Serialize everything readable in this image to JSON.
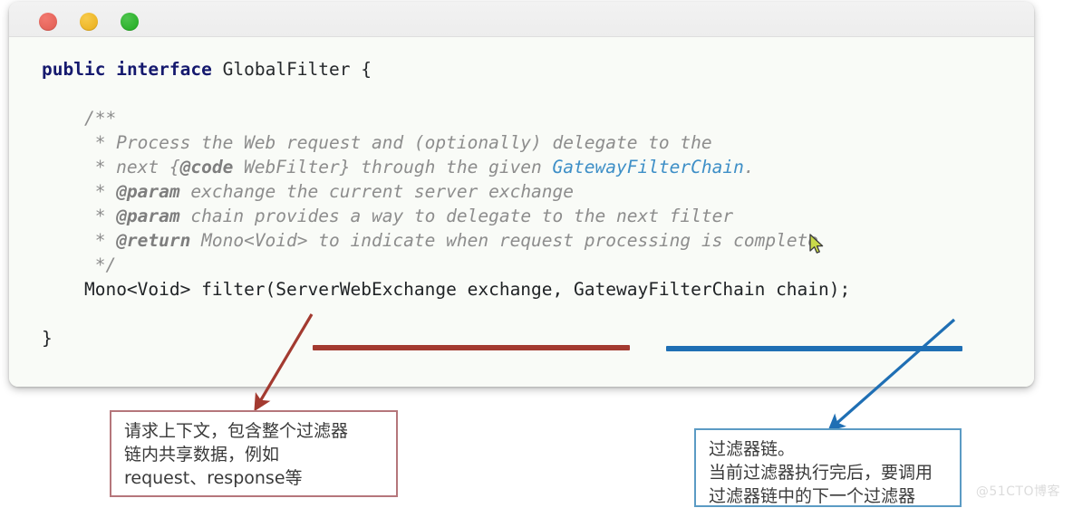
{
  "window": {
    "traffic_lights": [
      {
        "name": "close",
        "color": "#e05a51"
      },
      {
        "name": "minimize",
        "color": "#e9ad18"
      },
      {
        "name": "zoom",
        "color": "#1faa1f"
      }
    ]
  },
  "code": {
    "language": "java",
    "lines": [
      {
        "id": "l1",
        "text": "public interface GlobalFilter {"
      },
      {
        "id": "l2",
        "text": ""
      },
      {
        "id": "l3",
        "text": "    /**"
      },
      {
        "id": "l4",
        "text": "     * Process the Web request and (optionally) delegate to the"
      },
      {
        "id": "l5",
        "text": "     * next {@code WebFilter} through the given GatewayFilterChain."
      },
      {
        "id": "l6",
        "text": "     * @param exchange the current server exchange"
      },
      {
        "id": "l7",
        "text": "     * @param chain provides a way to delegate to the next filter"
      },
      {
        "id": "l8",
        "text": "     * @return Mono<Void> to indicate when request processing is complete"
      },
      {
        "id": "l9",
        "text": "     */"
      },
      {
        "id": "l10",
        "text": "    Mono<Void> filter(ServerWebExchange exchange, GatewayFilterChain chain);"
      },
      {
        "id": "l11",
        "text": ""
      },
      {
        "id": "l12",
        "text": "}"
      }
    ],
    "tokens": {
      "kw_public": "public",
      "kw_interface": "interface",
      "type_globalfilter": "GlobalFilter {",
      "comment_open": "/**",
      "comment_line1_pre": "* Process the Web request and (optionally) delegate to the",
      "comment_line2_a": "* next {",
      "comment_line2_code": "@code",
      "comment_line2_b": " WebFilter} through the given ",
      "comment_line2_link": "GatewayFilterChain",
      "comment_line2_c": ".",
      "comment_line3_tag": "@param",
      "comment_line3_rest": " exchange the current server exchange",
      "comment_line4_tag": "@param",
      "comment_line4_rest": " chain provides a way to delegate to the next filter",
      "comment_line5_tag": "@return",
      "comment_line5_rest": " Mono<Void> to indicate when request processing is complete",
      "comment_close": "*/",
      "signature_a": "Mono<Void> filter(ServerWebExchange exchange, GatewayFilterChain chain);",
      "closing_brace": "}"
    }
  },
  "annotations": {
    "exchange": {
      "underline_color": "#a33a30",
      "arrow_color": "#a33a30",
      "text": "请求上下文，包含整个过滤器\n链内共享数据，例如\nrequest、response等"
    },
    "chain": {
      "underline_color": "#1f6fb4",
      "arrow_color": "#1f6fb4",
      "text": "过滤器链。\n当前过滤器执行完后，要调用\n过滤器链中的下一个过滤器"
    }
  },
  "watermark": {
    "text": "@51CTO博客"
  }
}
